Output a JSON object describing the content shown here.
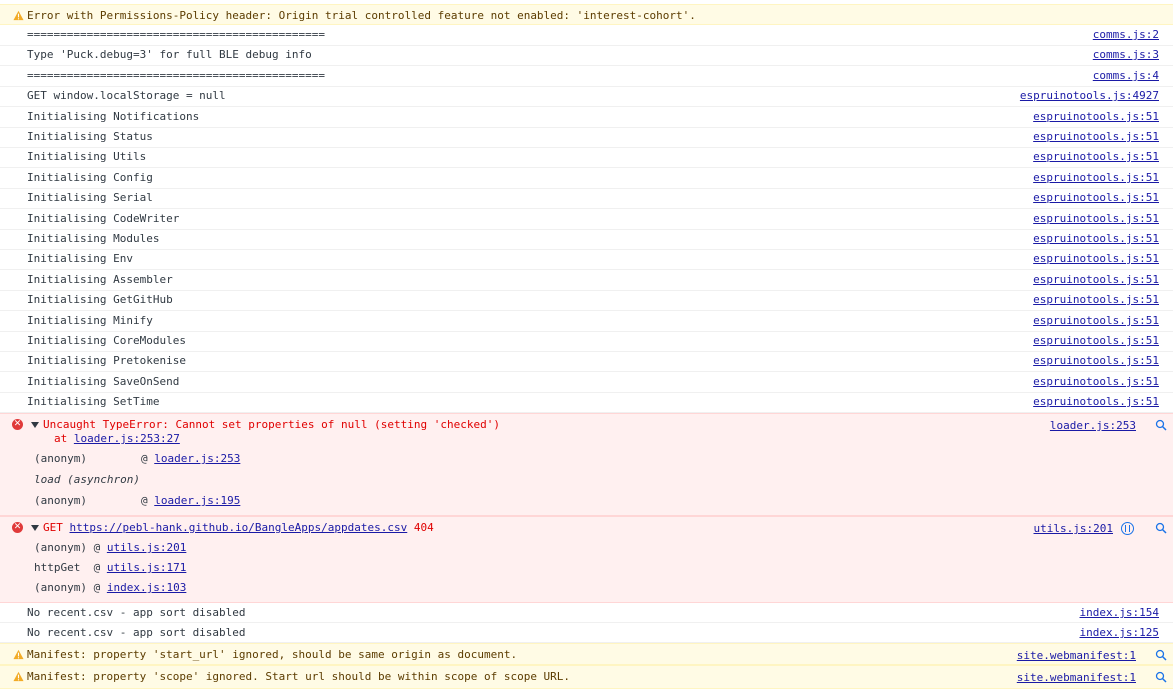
{
  "permissions_warning": {
    "text": "Error with Permissions-Policy header: Origin trial controlled feature not enabled: 'interest-cohort'."
  },
  "logs": [
    {
      "text": "=============================================",
      "source": "comms.js:2"
    },
    {
      "text": "Type 'Puck.debug=3' for full BLE debug info",
      "source": "comms.js:3"
    },
    {
      "text": "=============================================",
      "source": "comms.js:4"
    },
    {
      "text": "GET window.localStorage = null",
      "source": "espruinotools.js:4927"
    },
    {
      "text": "Initialising Notifications",
      "source": "espruinotools.js:51"
    },
    {
      "text": "Initialising Status",
      "source": "espruinotools.js:51"
    },
    {
      "text": "Initialising Utils",
      "source": "espruinotools.js:51"
    },
    {
      "text": "Initialising Config",
      "source": "espruinotools.js:51"
    },
    {
      "text": "Initialising Serial",
      "source": "espruinotools.js:51"
    },
    {
      "text": "Initialising CodeWriter",
      "source": "espruinotools.js:51"
    },
    {
      "text": "Initialising Modules",
      "source": "espruinotools.js:51"
    },
    {
      "text": "Initialising Env",
      "source": "espruinotools.js:51"
    },
    {
      "text": "Initialising Assembler",
      "source": "espruinotools.js:51"
    },
    {
      "text": "Initialising GetGitHub",
      "source": "espruinotools.js:51"
    },
    {
      "text": "Initialising Minify",
      "source": "espruinotools.js:51"
    },
    {
      "text": "Initialising CoreModules",
      "source": "espruinotools.js:51"
    },
    {
      "text": "Initialising Pretokenise",
      "source": "espruinotools.js:51"
    },
    {
      "text": "Initialising SaveOnSend",
      "source": "espruinotools.js:51"
    },
    {
      "text": "Initialising SetTime",
      "source": "espruinotools.js:51"
    }
  ],
  "type_error": {
    "message": "Uncaught TypeError: Cannot set properties of null (setting 'checked')",
    "at_prefix": "at ",
    "at_link": "loader.js:253:27",
    "source": "loader.js:253",
    "stack": [
      {
        "fn": "(anonym)",
        "link": "loader.js:253"
      },
      {
        "fn": "load (asynchron)",
        "link": ""
      },
      {
        "fn": "(anonym)",
        "link": "loader.js:195"
      }
    ]
  },
  "get_error": {
    "method": "GET",
    "url": "https://pebl-hank.github.io/BangleApps/appdates.csv",
    "status": "404",
    "source": "utils.js:201",
    "stack": [
      {
        "fn": "(anonym)",
        "link": "utils.js:201"
      },
      {
        "fn": "httpGet ",
        "link": "utils.js:171"
      },
      {
        "fn": "(anonym)",
        "link": "index.js:103"
      }
    ]
  },
  "recent_logs": [
    {
      "text": "No recent.csv - app sort disabled",
      "source": "index.js:154"
    },
    {
      "text": "No recent.csv - app sort disabled",
      "source": "index.js:125"
    }
  ],
  "manifest_warnings": [
    {
      "text": "Manifest: property 'start_url' ignored, should be same origin as document.",
      "source": "site.webmanifest:1"
    },
    {
      "text": "Manifest: property 'scope' ignored. Start url should be within scope of scope URL.",
      "source": "site.webmanifest:1"
    }
  ],
  "colors": {
    "error": "#e00000",
    "warning_bg": "#fffbe5",
    "error_bg": "#fff0f0",
    "link": "#1a1aa6"
  },
  "icons": {
    "warning": "warning-triangle-icon",
    "error": "error-circle-icon",
    "expand": "expand-caret-icon",
    "search": "magnifier-icon",
    "network": "network-request-icon"
  }
}
